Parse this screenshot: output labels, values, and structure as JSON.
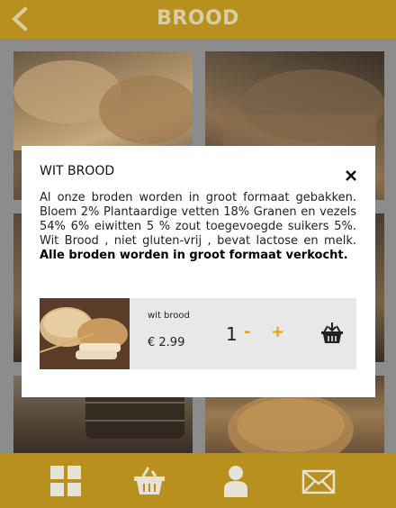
{
  "header": {
    "title": "BROOD",
    "back_icon": "chevron-left-icon"
  },
  "grid": {
    "tiles": [
      "bread-photo",
      "bread-photo",
      "bread-photo",
      "bread-photo",
      "bread-photo",
      "bread-photo"
    ]
  },
  "modal": {
    "title": "WIT BROOD",
    "close_icon": "close-icon",
    "description_plain": "Al onze broden worden in groot formaat gebakken. Bloem 2% Plantaardige vetten 18% Granen en vezels 54% 6% eiwitten 5 % zout toegevoegde suikers 5%. Wit Brood , niet gluten-vrij , bevat lactose en melk.",
    "description_bold": "Alle broden worden in groot formaat verkocht.",
    "product": {
      "name": "wit brood",
      "price": "€ 2.99",
      "quantity": "1",
      "minus_label": "-",
      "plus_label": "+",
      "add_to_cart_icon": "basket-icon"
    }
  },
  "footer": {
    "items": [
      {
        "icon": "grid-icon"
      },
      {
        "icon": "basket-icon"
      },
      {
        "icon": "user-icon"
      },
      {
        "icon": "mail-icon"
      }
    ]
  },
  "colors": {
    "brand": "#b8901e",
    "accent": "#e8a00d",
    "header_text": "#d9cda6"
  }
}
